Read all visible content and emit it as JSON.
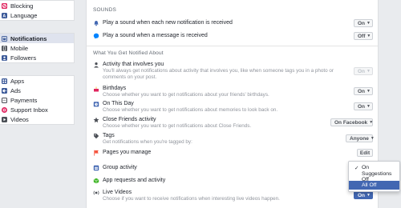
{
  "sidebar": {
    "group1": [
      {
        "label": "Blocking",
        "icon": "blocking-icon"
      },
      {
        "label": "Language",
        "icon": "language-icon"
      }
    ],
    "group2": [
      {
        "label": "Notifications",
        "icon": "notifications-icon",
        "active": true
      },
      {
        "label": "Mobile",
        "icon": "mobile-icon"
      },
      {
        "label": "Followers",
        "icon": "followers-icon"
      }
    ],
    "group3": [
      {
        "label": "Apps",
        "icon": "apps-icon"
      },
      {
        "label": "Ads",
        "icon": "ads-icon"
      },
      {
        "label": "Payments",
        "icon": "payments-icon"
      },
      {
        "label": "Support Inbox",
        "icon": "support-inbox-icon"
      },
      {
        "label": "Videos",
        "icon": "videos-icon"
      }
    ]
  },
  "sounds": {
    "title": "SOUNDS",
    "rows": [
      {
        "label": "Play a sound when each new notification is received",
        "value": "On"
      },
      {
        "label": "Play a sound when a message is received",
        "value": "Off"
      }
    ]
  },
  "notified": {
    "title": "What You Get Notified About",
    "rows": [
      {
        "title": "Activity that involves you",
        "desc": "You'll always get notifications about activity that involves you, like when someone tags you in a photo or comments on your post.",
        "value": "On"
      },
      {
        "title": "Birthdays",
        "desc": "Choose whether you want to get notifications about your friends' birthdays.",
        "value": "On"
      },
      {
        "title": "On This Day",
        "desc": "Choose whether you want to get notifications about memories to look back on.",
        "value": "On"
      },
      {
        "title": "Close Friends activity",
        "desc": "Choose whether you want to get notifications about Close Friends.",
        "value": "On Facebook"
      },
      {
        "title": "Tags",
        "desc": "Get notifications when you're tagged by:",
        "value": "Anyone"
      },
      {
        "title": "Pages you manage",
        "desc": "",
        "value": "Edit"
      },
      {
        "title": "Group activity",
        "desc": "",
        "value": ""
      },
      {
        "title": "App requests and activity",
        "desc": "",
        "value": ""
      },
      {
        "title": "Live Videos",
        "desc": "Choose if you want to receive notifications when interesting live videos happen.",
        "value": "On"
      }
    ]
  },
  "menu": {
    "items": [
      "On",
      "Suggestions Off",
      "All Off"
    ],
    "checked": "On",
    "highlighted": "All Off"
  },
  "colors": {
    "accent": "#4267b2",
    "active_bg": "#dfe3ee",
    "page_bg": "#e9ebee"
  }
}
